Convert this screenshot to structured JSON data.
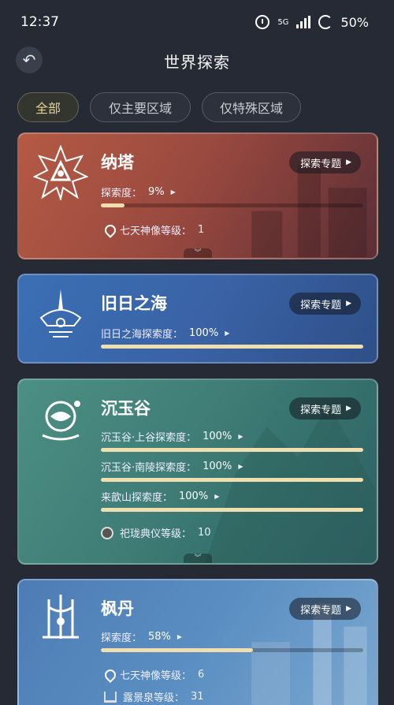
{
  "status": {
    "time": "12:37",
    "battery": "50%",
    "network": "5G"
  },
  "header": {
    "title": "世界探索"
  },
  "filters": [
    {
      "label": "全部",
      "active": true
    },
    {
      "label": "仅主要区域",
      "active": false
    },
    {
      "label": "仅特殊区域",
      "active": false
    }
  ],
  "topic_label": "探索专题",
  "regions": {
    "nata": {
      "name": "纳塔",
      "progress": [
        {
          "label": "探索度：",
          "value": "9%",
          "fraction": 0.09
        }
      ],
      "info": [
        {
          "icon": "statue-pin-icon",
          "label": "七天神像等级：",
          "value": "1"
        }
      ]
    },
    "old_sea": {
      "name": "旧日之海",
      "progress": [
        {
          "label": "旧日之海探索度：",
          "value": "100%",
          "fraction": 1.0
        }
      ]
    },
    "chenyu": {
      "name": "沉玉谷",
      "progress": [
        {
          "label": "沉玉谷·上谷探索度：",
          "value": "100%",
          "fraction": 1.0
        },
        {
          "label": "沉玉谷·南陵探索度：",
          "value": "100%",
          "fraction": 1.0
        },
        {
          "label": "来歆山探索度：",
          "value": "100%",
          "fraction": 1.0
        }
      ],
      "info": [
        {
          "icon": "rite-icon",
          "label": "祀珑典仪等级：",
          "value": "10"
        }
      ]
    },
    "fontaine": {
      "name": "枫丹",
      "progress": [
        {
          "label": "探索度：",
          "value": "58%",
          "fraction": 0.58
        }
      ],
      "info": [
        {
          "icon": "statue-pin-icon",
          "label": "七天神像等级：",
          "value": "6"
        },
        {
          "icon": "spring-icon",
          "label": "露景泉等级：",
          "value": "31"
        }
      ]
    }
  },
  "colors": {
    "accent_gold": "#e8cf95",
    "bar_fill": "#f0dfae"
  }
}
